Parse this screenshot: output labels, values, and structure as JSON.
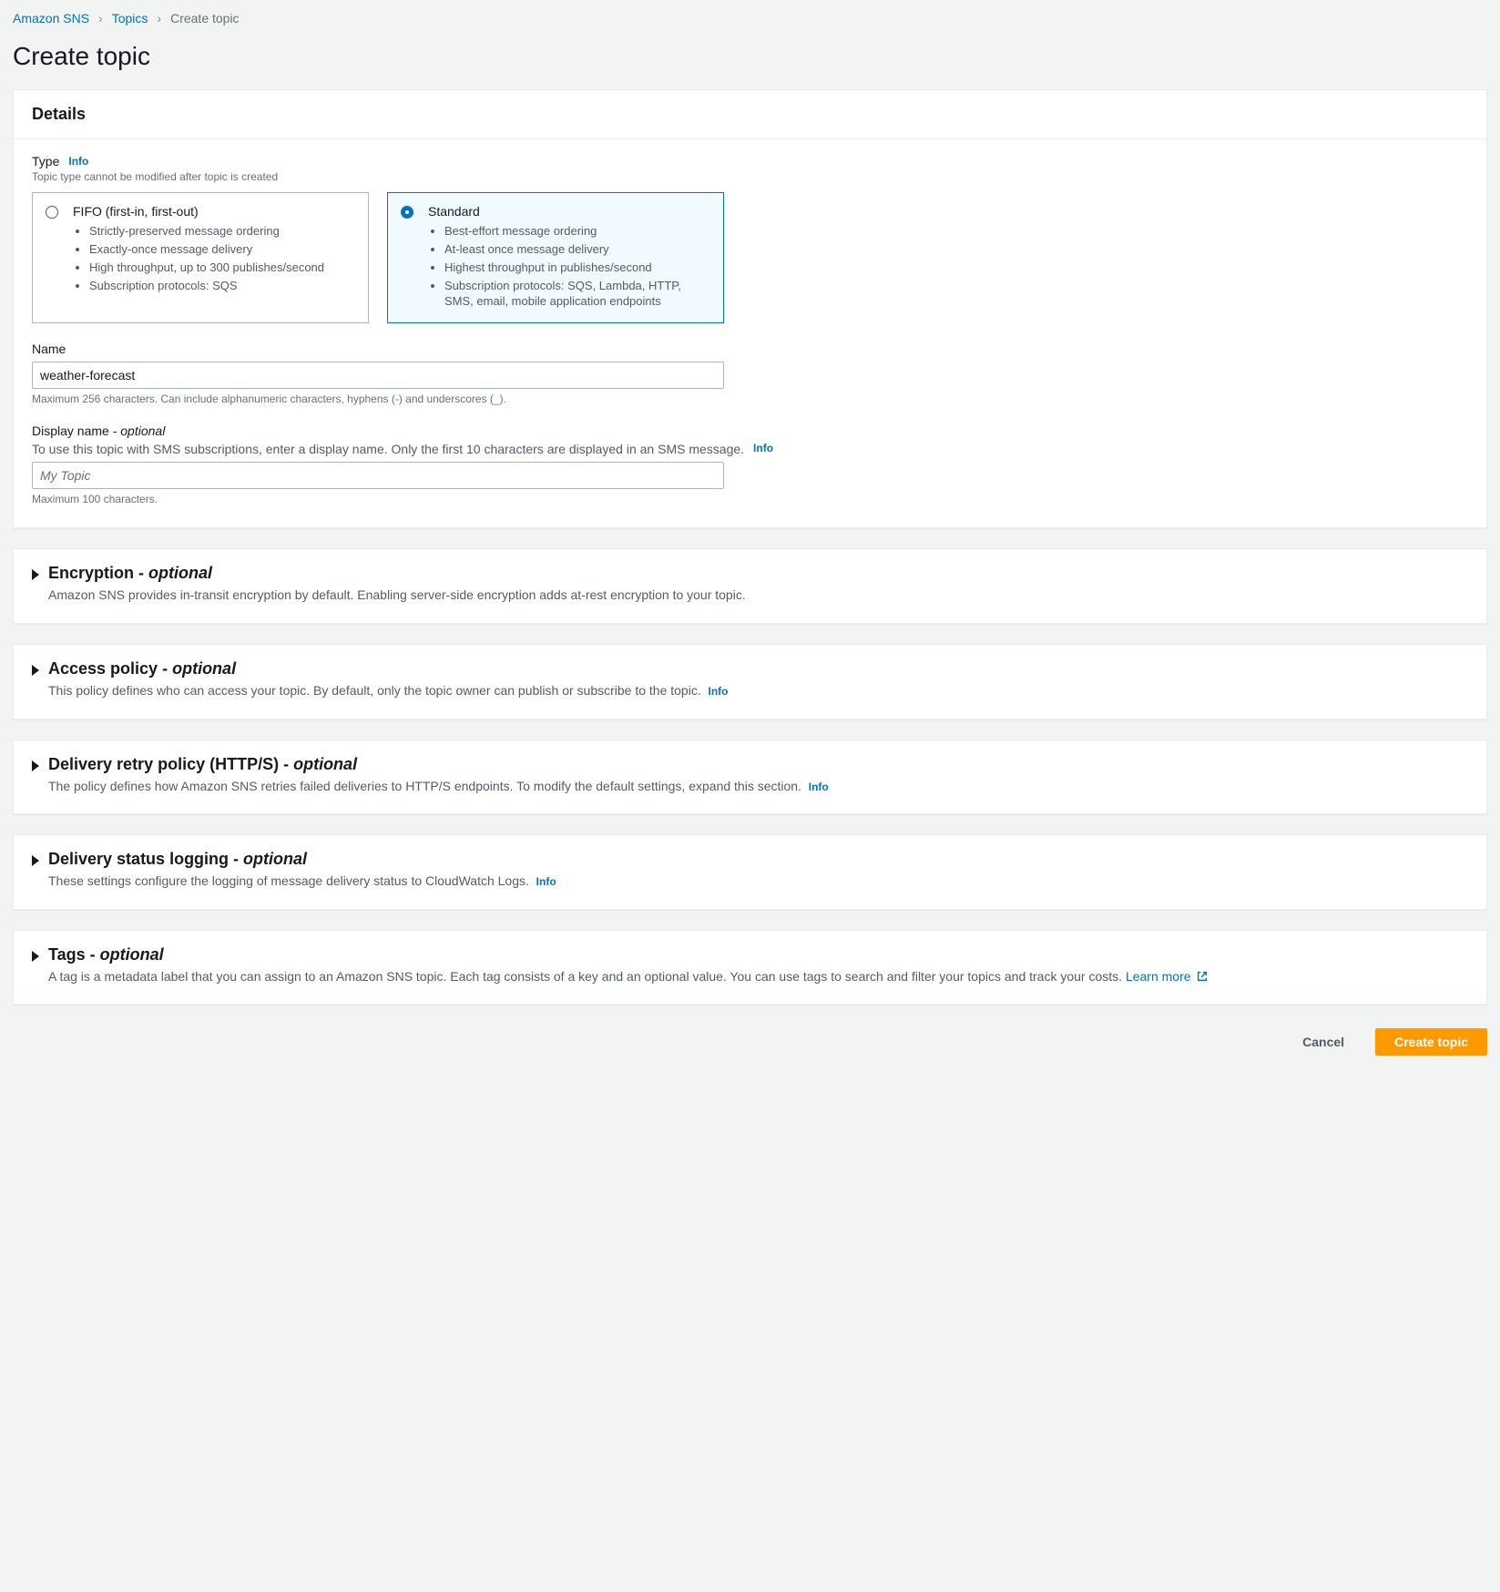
{
  "breadcrumbs": {
    "root": "Amazon SNS",
    "topics": "Topics",
    "current": "Create topic"
  },
  "page_title": "Create topic",
  "details": {
    "header": "Details",
    "type_label": "Type",
    "type_info": "Info",
    "type_sub": "Topic type cannot be modified after topic is created",
    "fifo": {
      "title": "FIFO (first-in, first-out)",
      "b1": "Strictly-preserved message ordering",
      "b2": "Exactly-once message delivery",
      "b3": "High throughput, up to 300 publishes/second",
      "b4": "Subscription protocols: SQS"
    },
    "standard": {
      "title": "Standard",
      "b1": "Best-effort message ordering",
      "b2": "At-least once message delivery",
      "b3": "Highest throughput in publishes/second",
      "b4": "Subscription protocols: SQS, Lambda, HTTP, SMS, email, mobile application endpoints"
    },
    "name_label": "Name",
    "name_value": "weather-forecast",
    "name_hint": "Maximum 256 characters. Can include alphanumeric characters, hyphens (-) and underscores (_).",
    "display_label": "Display name - ",
    "display_opt": "optional",
    "display_sub": "To use this topic with SMS subscriptions, enter a display name. Only the first 10 characters are displayed in an SMS message.",
    "display_info": "Info",
    "display_placeholder": "My Topic",
    "display_hint": "Maximum 100 characters."
  },
  "sections": {
    "encryption": {
      "title": "Encryption - ",
      "opt": "optional",
      "sub": "Amazon SNS provides in-transit encryption by default. Enabling server-side encryption adds at-rest encryption to your topic."
    },
    "access": {
      "title": "Access policy - ",
      "opt": "optional",
      "sub": "This policy defines who can access your topic. By default, only the topic owner can publish or subscribe to the topic.",
      "info": "Info"
    },
    "retry": {
      "title": "Delivery retry policy (HTTP/S) - ",
      "opt": "optional",
      "sub": "The policy defines how Amazon SNS retries failed deliveries to HTTP/S endpoints. To modify the default settings, expand this section.",
      "info": "Info"
    },
    "logging": {
      "title": "Delivery status logging - ",
      "opt": "optional",
      "sub": "These settings configure the logging of message delivery status to CloudWatch Logs.",
      "info": "Info"
    },
    "tags": {
      "title": "Tags - ",
      "opt": "optional",
      "sub": "A tag is a metadata label that you can assign to an Amazon SNS topic. Each tag consists of a key and an optional value. You can use tags to search and filter your topics and track your costs. ",
      "learn": "Learn more"
    }
  },
  "footer": {
    "cancel": "Cancel",
    "create": "Create topic"
  }
}
